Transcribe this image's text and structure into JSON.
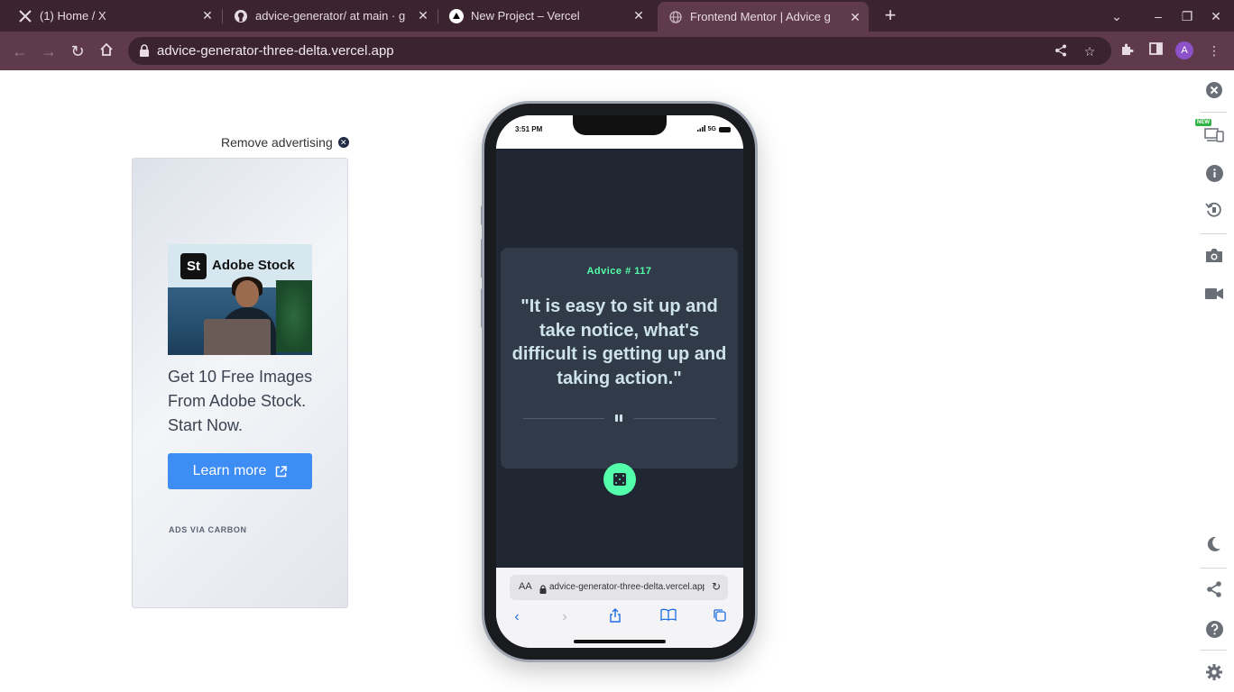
{
  "browser": {
    "tabs": [
      {
        "title": "(1) Home / X",
        "favicon": "x-logo-icon",
        "active": false
      },
      {
        "title": "advice-generator/ at main · g",
        "favicon": "github-icon",
        "active": false
      },
      {
        "title": "New Project – Vercel",
        "favicon": "vercel-icon",
        "active": false
      },
      {
        "title": "Frontend Mentor | Advice g",
        "favicon": "globe-icon",
        "active": true
      }
    ],
    "url": "advice-generator-three-delta.vercel.app",
    "profile_initial": "A",
    "colors": {
      "tabbar": "#3b2430",
      "toolbar": "#5e3a4c",
      "profile": "#8d52c9"
    }
  },
  "ad": {
    "remove_label": "Remove advertising",
    "image_brand_mark": "St",
    "image_brand_name": "Adobe Stock",
    "headline": "Get 10 Free Images From Adobe Stock. Start Now.",
    "button_label": "Learn more",
    "footer": "ADS VIA CARBON",
    "colors": {
      "button": "#3d8df5"
    }
  },
  "phone": {
    "status_time": "3:51 PM",
    "status_network": "5G",
    "advice_id_label": "Advice # 117",
    "advice_text": "\"It is easy to sit up and take notice, what's difficult is getting up and taking action.\"",
    "safari_aa": "AA",
    "safari_url": "advice-generator-three-delta.vercel.app",
    "colors": {
      "accent": "#53ffaa",
      "card": "#313a49",
      "background": "#202632",
      "text": "#cee3e9"
    }
  },
  "sidebar": {
    "new_badge": "NEW",
    "icons": [
      "close-icon",
      "responsive-devices-icon",
      "info-icon",
      "rotate-icon",
      "camera-icon",
      "video-icon",
      "moon-icon",
      "share-icon",
      "help-icon",
      "settings-icon"
    ]
  }
}
